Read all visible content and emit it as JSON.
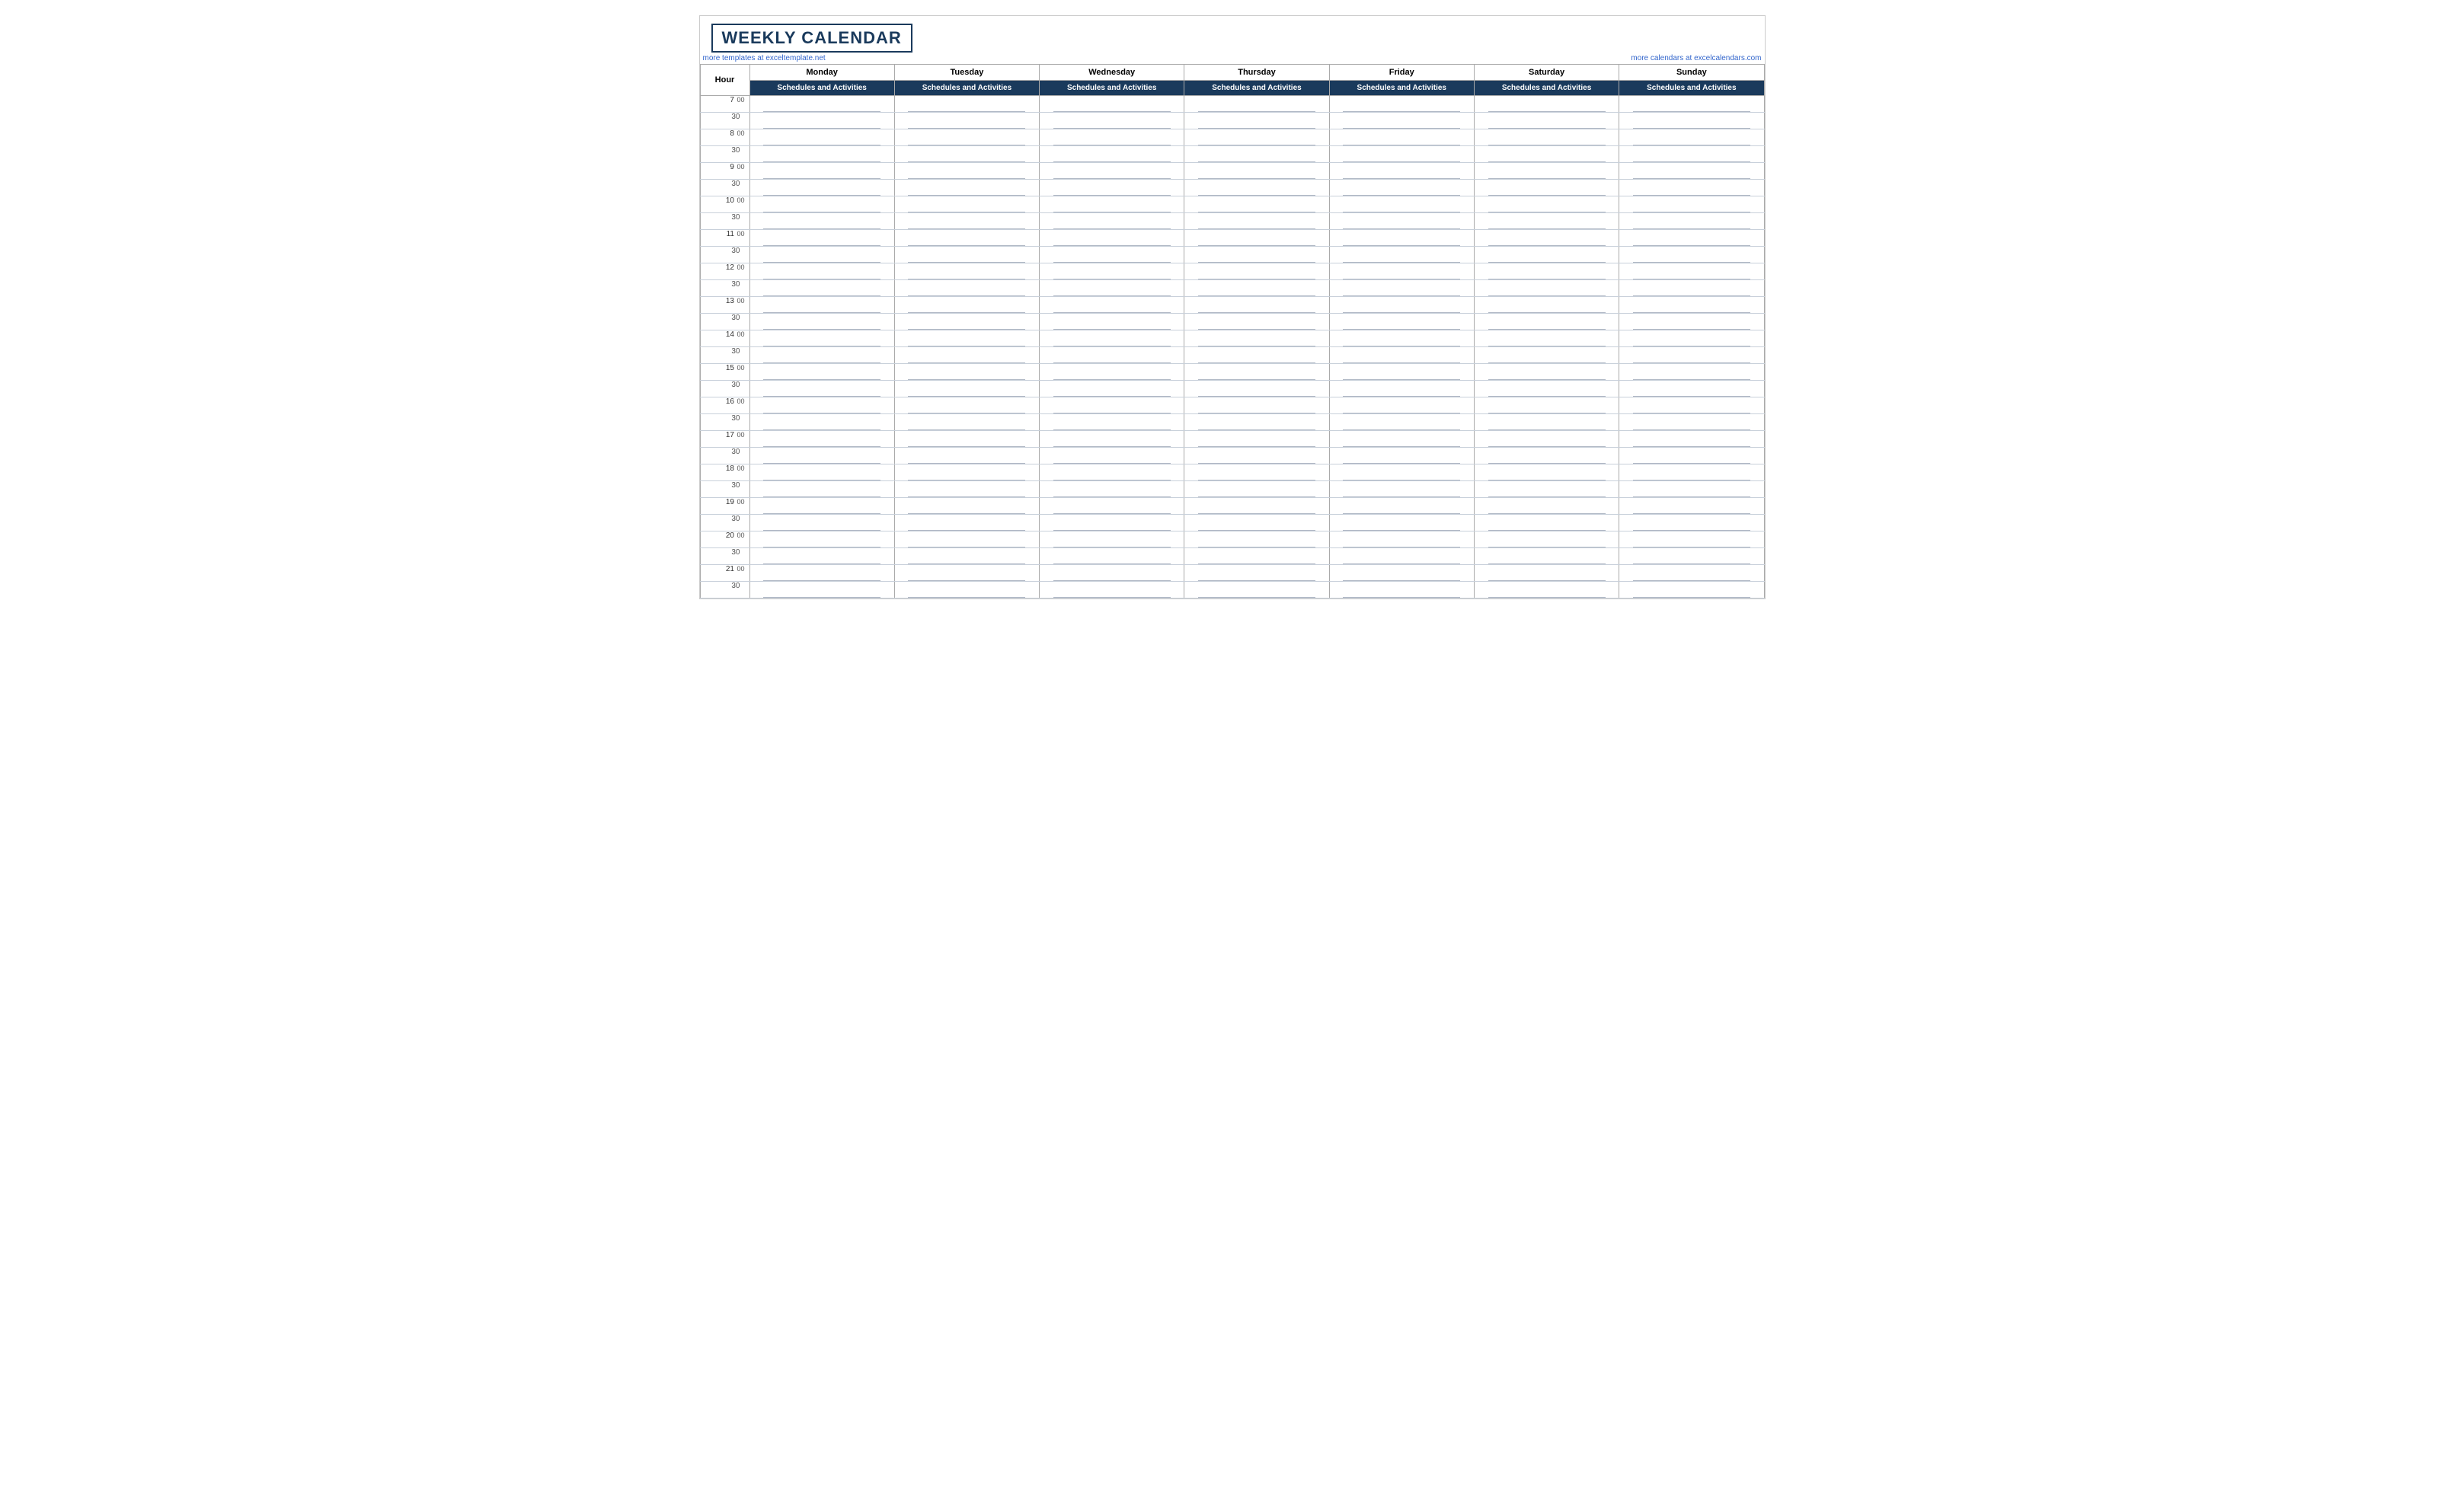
{
  "header": {
    "title": "WEEKLY CALENDAR",
    "link_left": "more templates at exceltemplate.net",
    "link_right": "more calendars at excelcalendars.com"
  },
  "columns": {
    "hour_label": "Hour",
    "days": [
      "Monday",
      "Tuesday",
      "Wednesday",
      "Thursday",
      "Friday",
      "Saturday",
      "Sunday"
    ],
    "subheader": "Schedules and Activities"
  },
  "time_slots": [
    {
      "hour": "7",
      "mins": "00"
    },
    {
      "hour": "",
      "mins": "30"
    },
    {
      "hour": "8",
      "mins": "00"
    },
    {
      "hour": "",
      "mins": "30"
    },
    {
      "hour": "9",
      "mins": "00"
    },
    {
      "hour": "",
      "mins": "30"
    },
    {
      "hour": "10",
      "mins": "00"
    },
    {
      "hour": "",
      "mins": "30"
    },
    {
      "hour": "11",
      "mins": "00"
    },
    {
      "hour": "",
      "mins": "30"
    },
    {
      "hour": "12",
      "mins": "00"
    },
    {
      "hour": "",
      "mins": "30"
    },
    {
      "hour": "13",
      "mins": "00"
    },
    {
      "hour": "",
      "mins": "30"
    },
    {
      "hour": "14",
      "mins": "00"
    },
    {
      "hour": "",
      "mins": "30"
    },
    {
      "hour": "15",
      "mins": "00"
    },
    {
      "hour": "",
      "mins": "30"
    },
    {
      "hour": "16",
      "mins": "00"
    },
    {
      "hour": "",
      "mins": "30"
    },
    {
      "hour": "17",
      "mins": "00"
    },
    {
      "hour": "",
      "mins": "30"
    },
    {
      "hour": "18",
      "mins": "00"
    },
    {
      "hour": "",
      "mins": "30"
    },
    {
      "hour": "19",
      "mins": "00"
    },
    {
      "hour": "",
      "mins": "30"
    },
    {
      "hour": "20",
      "mins": "00"
    },
    {
      "hour": "",
      "mins": "30"
    },
    {
      "hour": "21",
      "mins": "00"
    },
    {
      "hour": "",
      "mins": "30"
    }
  ]
}
